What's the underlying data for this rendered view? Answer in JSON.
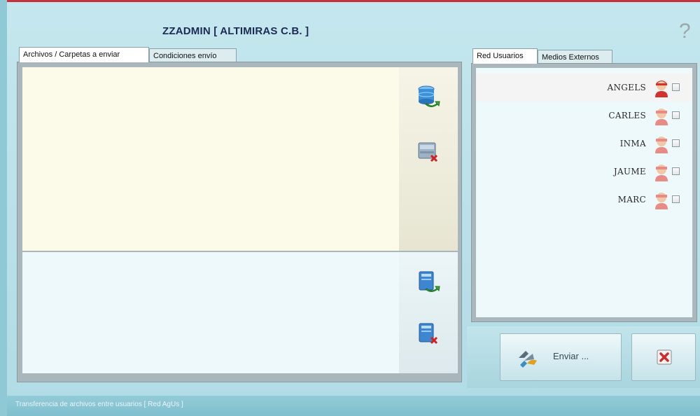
{
  "window": {
    "title": "ZZADMIN  [ ALTIMIRAS C.B. ]",
    "help_symbol": "?"
  },
  "left_tabs": [
    {
      "label": "Archivos / Carpetas a enviar",
      "active": true
    },
    {
      "label": "Condiciones envío",
      "active": false
    }
  ],
  "right_tabs": [
    {
      "label": "Red Usuarios",
      "active": true
    },
    {
      "label": "Medios Externos",
      "active": false
    }
  ],
  "users": [
    {
      "name": "ANGELS",
      "checked": false,
      "selected": true
    },
    {
      "name": "CARLES",
      "checked": false,
      "selected": false
    },
    {
      "name": "INMA",
      "checked": false,
      "selected": false
    },
    {
      "name": "JAUME",
      "checked": false,
      "selected": false
    },
    {
      "name": "MARC",
      "checked": false,
      "selected": false
    }
  ],
  "buttons": {
    "send_label": "Enviar ..."
  },
  "icons": {
    "add_folder": "database-add-icon",
    "remove_folder": "database-remove-icon",
    "add_file": "server-add-icon",
    "remove_file": "server-remove-icon",
    "send": "send-arrows-icon",
    "close": "close-icon",
    "user": "user-avatar-icon"
  },
  "status": {
    "text": "Transferencia de archivos entre usuarios [ Red AgUs ]"
  },
  "colors": {
    "accent_red": "#c8323c",
    "window_bg": "#b8dde6"
  }
}
